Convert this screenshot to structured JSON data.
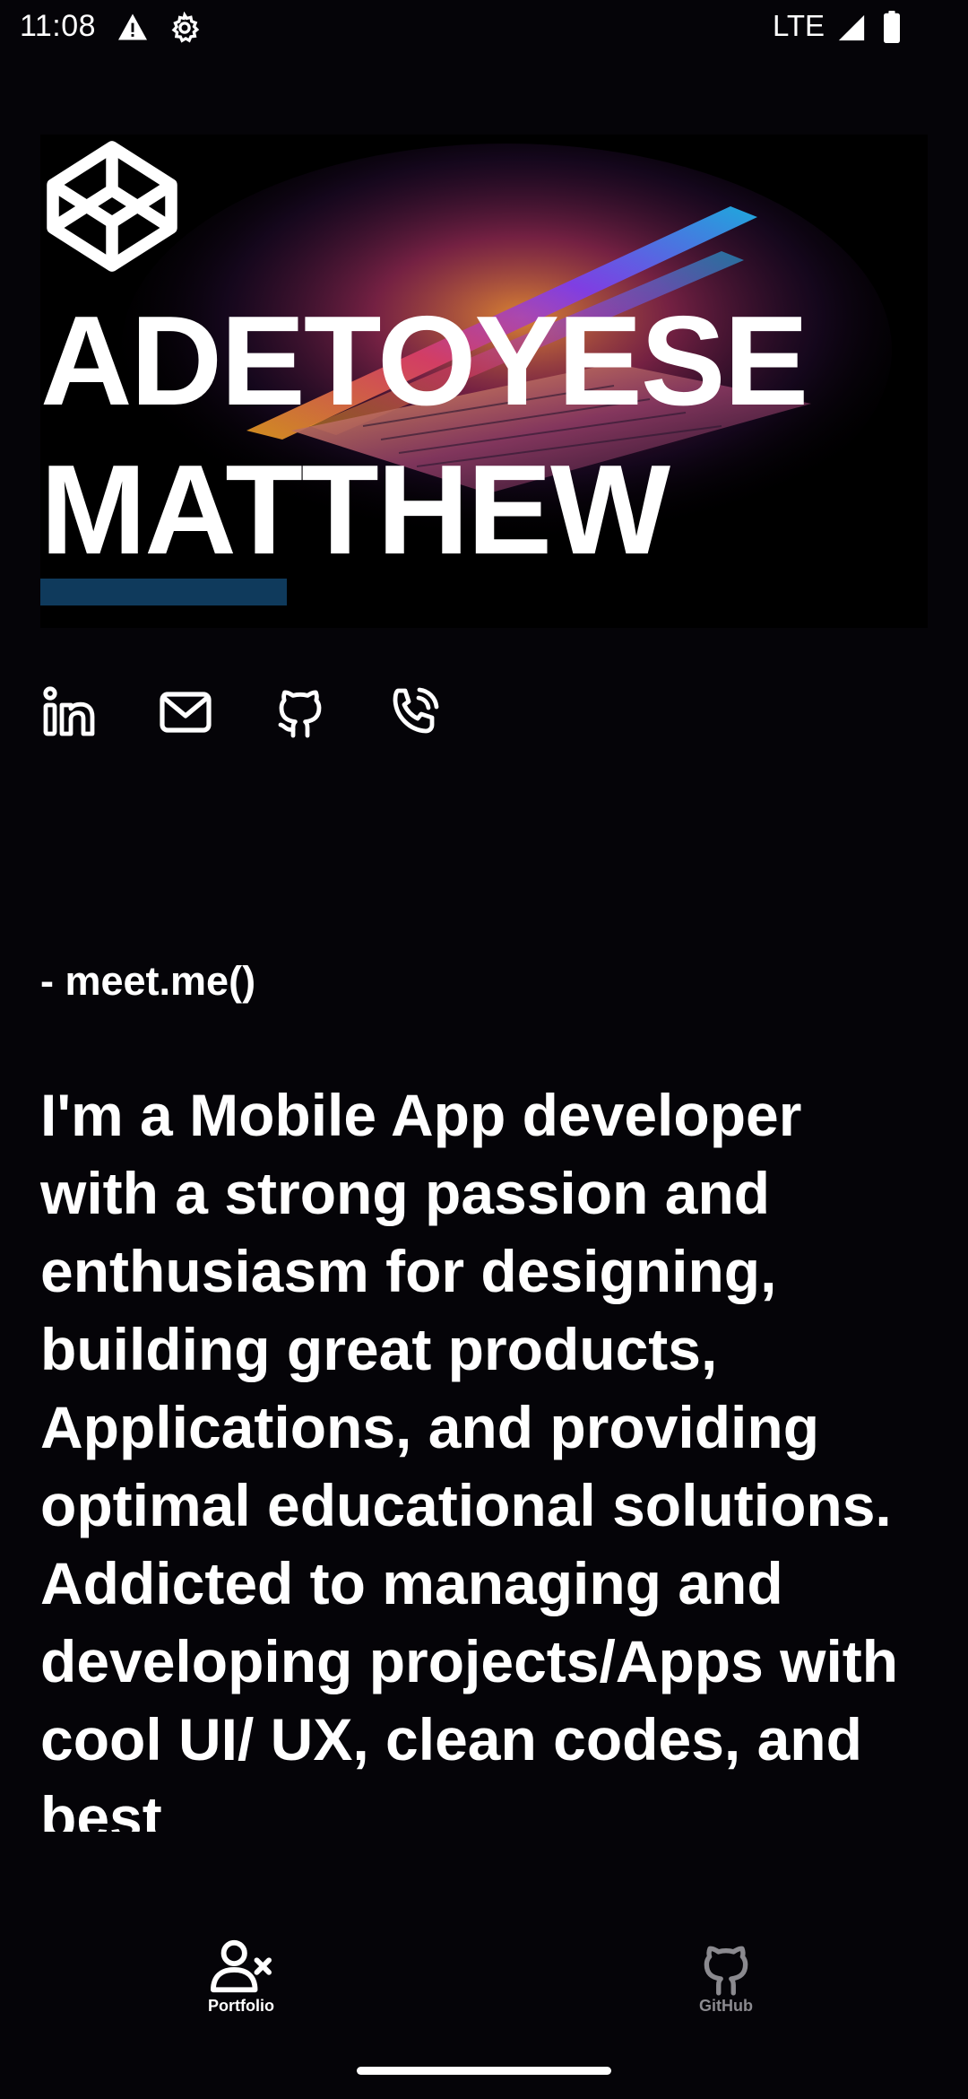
{
  "status_bar": {
    "time": "11:08",
    "network": "LTE",
    "icons": [
      "warning-icon",
      "settings-gear-icon",
      "signal-icon",
      "battery-icon"
    ]
  },
  "hero": {
    "logo_icon": "codepen-cube-icon",
    "name_line1": "ADETOYESE",
    "name_line2": "MATTHEW",
    "accent_color": "#0f3a5c"
  },
  "socials": [
    {
      "name": "linkedin",
      "icon": "linkedin-icon"
    },
    {
      "name": "email",
      "icon": "mail-icon"
    },
    {
      "name": "github",
      "icon": "github-icon"
    },
    {
      "name": "phone",
      "icon": "phone-icon"
    }
  ],
  "intro": {
    "tag": "- meet.me()",
    "bio": "I'm a Mobile App developer with a strong passion and enthusiasm for designing, building great products, Applications, and providing optimal educational solutions. Addicted to managing and developing projects/Apps with cool UI/ UX, clean codes, and best"
  },
  "bottom_nav": {
    "items": [
      {
        "label": "Portfolio",
        "icon": "person-remove-icon",
        "active": true
      },
      {
        "label": "GitHub",
        "icon": "github-icon",
        "active": false
      }
    ],
    "active_color": "#ffffff",
    "inactive_color": "#8b8a8f"
  }
}
